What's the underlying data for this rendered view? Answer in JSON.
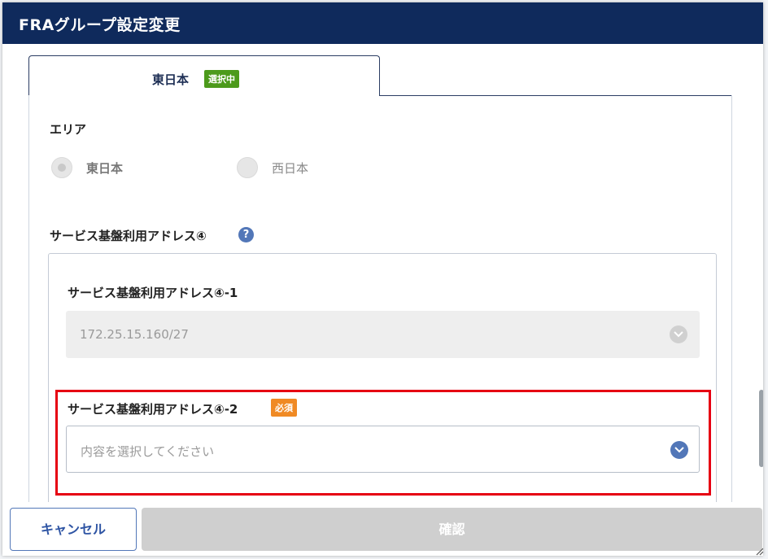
{
  "modal": {
    "title": "FRAグループ設定変更"
  },
  "tab": {
    "label": "東日本",
    "badge": "選択中"
  },
  "area": {
    "label": "エリア",
    "options": [
      {
        "label": "東日本",
        "checked": true
      },
      {
        "label": "西日本",
        "checked": false
      }
    ]
  },
  "service_address": {
    "label": "サービス基盤利用アドレス④",
    "help_icon": "question-icon",
    "field1": {
      "label": "サービス基盤利用アドレス④-1",
      "value": "172.25.15.160/27",
      "disabled": true
    },
    "field2": {
      "label": "サービス基盤利用アドレス④-2",
      "required_badge": "必須",
      "placeholder": "内容を選択してください"
    }
  },
  "footer": {
    "cancel_label": "キャンセル",
    "confirm_label": "確認"
  },
  "colors": {
    "header_bg": "#0f2a5c",
    "accent": "#5277b8",
    "selected_badge": "#4c9a1b",
    "required_badge": "#f08a24",
    "highlight": "#e60012"
  }
}
